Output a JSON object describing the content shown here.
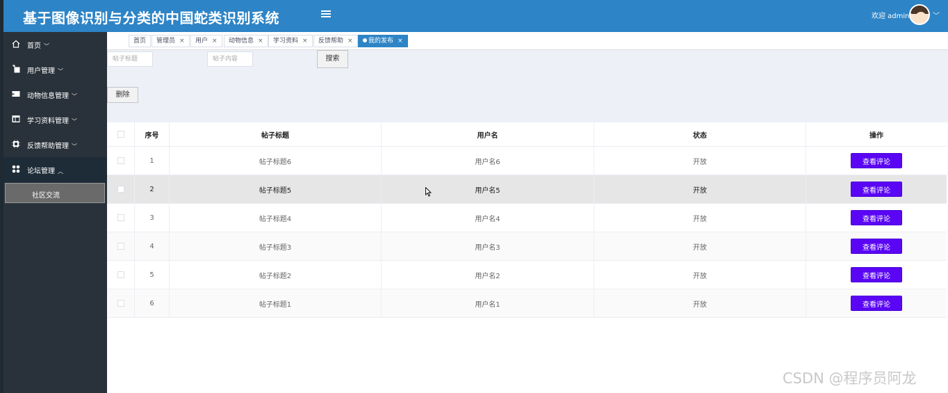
{
  "header": {
    "title": "基于图像识别与分类的中国蛇类识别系统",
    "welcome": "欢迎 admin",
    "brand_color": "#2d84c6"
  },
  "sidebar": {
    "items": [
      {
        "label": "首页",
        "icon": "home-icon",
        "caret": "﹀"
      },
      {
        "label": "用户管理",
        "icon": "user-manage-icon",
        "caret": "﹀"
      },
      {
        "label": "动物信息管理",
        "icon": "animal-info-icon",
        "caret": "﹀"
      },
      {
        "label": "学习资料管理",
        "icon": "study-material-icon",
        "caret": "﹀"
      },
      {
        "label": "反馈帮助管理",
        "icon": "feedback-icon",
        "caret": "﹀"
      },
      {
        "label": "论坛管理",
        "icon": "forum-icon",
        "caret": "︿"
      }
    ],
    "subitem": "社区交流"
  },
  "tabs": [
    {
      "label": "首页",
      "closable": false
    },
    {
      "label": "管理员",
      "closable": true
    },
    {
      "label": "用户",
      "closable": true
    },
    {
      "label": "动物信息",
      "closable": true
    },
    {
      "label": "学习资料",
      "closable": true
    },
    {
      "label": "反馈帮助",
      "closable": true
    },
    {
      "label": "我的发布",
      "closable": true,
      "active": true
    }
  ],
  "tab_close": "×",
  "filters": {
    "title_placeholder": "帖子标题",
    "content_placeholder": "帖子内容",
    "search_label": "搜索",
    "delete_label": "删除"
  },
  "table": {
    "columns": [
      "序号",
      "帖子标题",
      "用户名",
      "状态",
      "操作"
    ],
    "rows": [
      {
        "index": "1",
        "title": "帖子标题6",
        "username": "用户名6",
        "status": "开放",
        "action": "查看评论"
      },
      {
        "index": "2",
        "title": "帖子标题5",
        "username": "用户名5",
        "status": "开放",
        "action": "查看评论"
      },
      {
        "index": "3",
        "title": "帖子标题4",
        "username": "用户名4",
        "status": "开放",
        "action": "查看评论"
      },
      {
        "index": "4",
        "title": "帖子标题3",
        "username": "用户名3",
        "status": "开放",
        "action": "查看评论"
      },
      {
        "index": "5",
        "title": "帖子标题2",
        "username": "用户名2",
        "status": "开放",
        "action": "查看评论"
      },
      {
        "index": "6",
        "title": "帖子标题1",
        "username": "用户名1",
        "status": "开放",
        "action": "查看评论"
      }
    ],
    "action_color": "#5a06f4"
  },
  "watermark": "CSDN @程序员阿龙"
}
